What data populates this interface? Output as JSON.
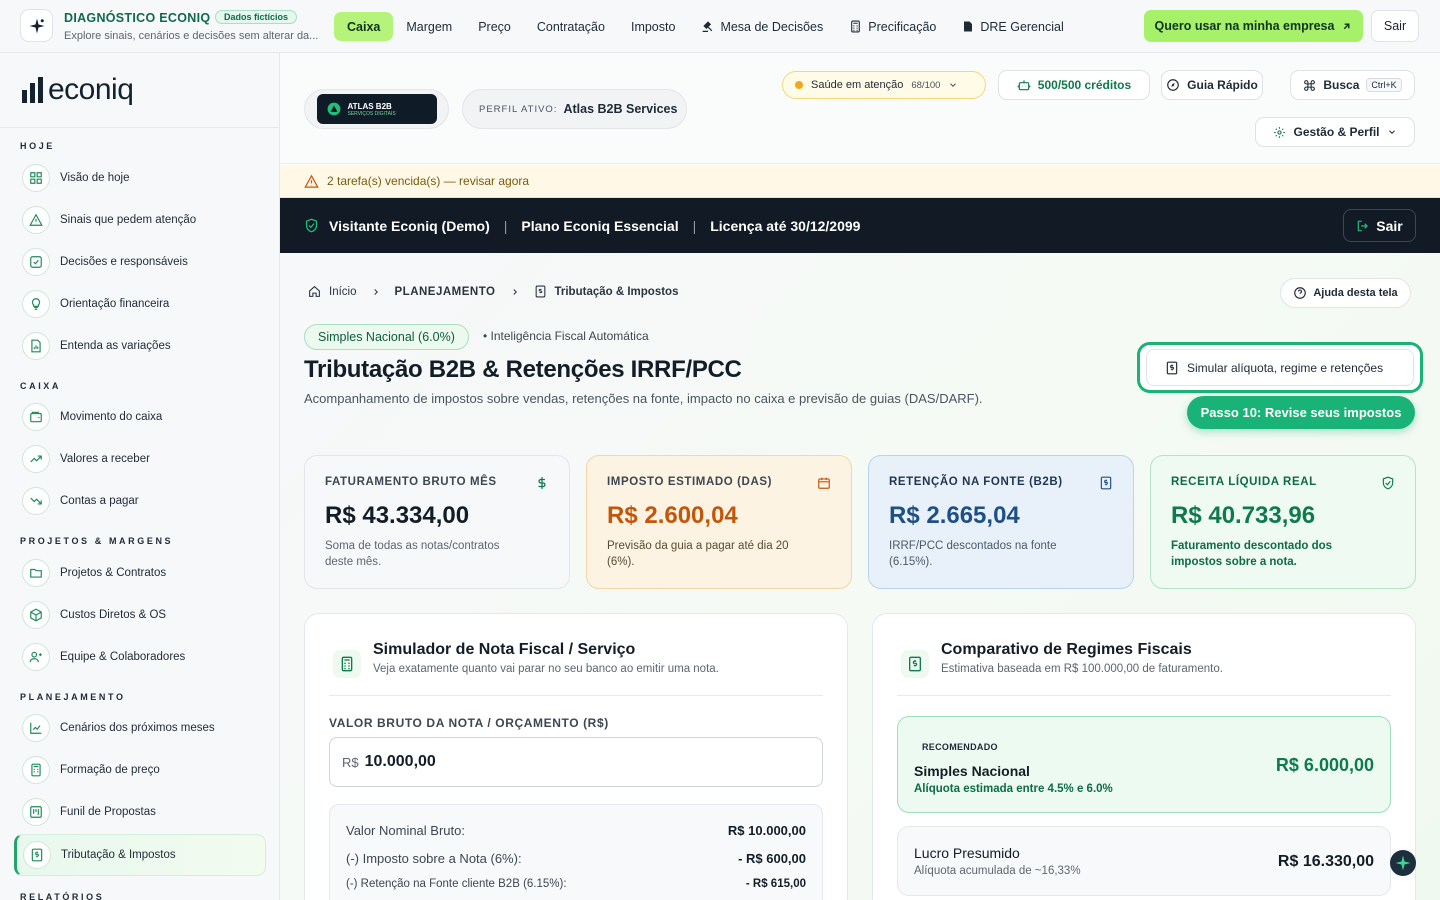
{
  "topbar": {
    "title": "DIAGNÓSTICO ECONIQ",
    "badge": "Dados fictícios",
    "subtitle": "Explore sinais, cenários e decisões sem alterar da...",
    "nav": [
      {
        "label": "Caixa",
        "icon": ""
      },
      {
        "label": "Margem",
        "icon": ""
      },
      {
        "label": "Preço",
        "icon": ""
      },
      {
        "label": "Contratação",
        "icon": ""
      },
      {
        "label": "Imposto",
        "icon": ""
      },
      {
        "label": "Mesa de Decisões",
        "icon": "gavel-icon"
      },
      {
        "label": "Precificação",
        "icon": "calculator-icon"
      },
      {
        "label": "DRE Gerencial",
        "icon": "document-icon"
      }
    ],
    "cta": "Quero usar na minha empresa",
    "exit": "Sair"
  },
  "sidebar": {
    "brand": "econiq",
    "sections": [
      {
        "title": "HOJE",
        "items": [
          "Visão de hoje",
          "Sinais que pedem atenção",
          "Decisões e responsáveis",
          "Orientação financeira",
          "Entenda as variações"
        ]
      },
      {
        "title": "CAIXA",
        "items": [
          "Movimento do caixa",
          "Valores a receber",
          "Contas a pagar"
        ]
      },
      {
        "title": "PROJETOS & MARGENS",
        "items": [
          "Projetos & Contratos",
          "Custos Diretos & OS",
          "Equipe & Colaboradores"
        ]
      },
      {
        "title": "PLANEJAMENTO",
        "items": [
          "Cenários dos próximos meses",
          "Formação de preço",
          "Funil de Propostas",
          "Tributação & Impostos"
        ]
      },
      {
        "title": "RELATÓRIOS",
        "items": []
      }
    ]
  },
  "header": {
    "account_name": "ATLAS B2B",
    "account_tagline": "SERVIÇOS DIGITAIS",
    "profile_key": "PERFIL ATIVO:",
    "profile_value": "Atlas B2B Services",
    "health_label": "Saúde em atenção",
    "health_score": "68/100",
    "credits": "500/500 créditos",
    "guide": "Guia Rápido",
    "search": "Busca",
    "search_kbd": "Ctrl+K",
    "settings": "Gestão & Perfil"
  },
  "alert": "2 tarefa(s) vencida(s) — revisar agora",
  "darkbar": {
    "user": "Visitante Econiq (Demo)",
    "plan": "Plano Econiq Essencial",
    "license": "Licença até 30/12/2099",
    "exit": "Sair"
  },
  "breadcrumb": {
    "home": "Início",
    "section": "PLANEJAMENTO",
    "page": "Tributação & Impostos"
  },
  "help": "Ajuda desta tela",
  "page": {
    "tag": "Simples Nacional (6.0%)",
    "tag2": "• Inteligência Fiscal Automática",
    "title": "Tributação B2B & Retenções IRRF/PCC",
    "subtitle": "Acompanhamento de impostos sobre vendas, retenções na fonte, impacto no caixa e previsão de guias (DAS/DARF).",
    "sim_button": "Simular alíquota, regime e retenções",
    "step": "Passo 10: Revise seus impostos"
  },
  "kpis": [
    {
      "title": "FATURAMENTO BRUTO MÊS",
      "value": "R$ 43.334,00",
      "desc": "Soma de todas as notas/contratos deste mês.",
      "color": "#131d28"
    },
    {
      "title": "IMPOSTO ESTIMADO (DAS)",
      "value": "R$ 2.600,04",
      "desc": "Previsão da guia a pagar até dia 20 (6%).",
      "color": "#c2570c"
    },
    {
      "title": "RETENÇÃO NA FONTE (B2B)",
      "value": "R$ 2.665,04",
      "desc": "IRRF/PCC descontados na fonte (6.15%).",
      "color": "#1e4f86"
    },
    {
      "title": "RECEITA LÍQUIDA REAL",
      "value": "R$ 40.733,96",
      "desc": "Faturamento descontado dos impostos sobre a nota.",
      "color": "#0f7a4e"
    }
  ],
  "simulator": {
    "title": "Simulador de Nota Fiscal / Serviço",
    "subtitle": "Veja exatamente quanto vai parar no seu banco ao emitir uma nota.",
    "input_label": "VALOR BRUTO DA NOTA / ORÇAMENTO (R$)",
    "currency": "R$",
    "input_value": "10.000,00",
    "rows": [
      {
        "label": "Valor Nominal Bruto:",
        "value": "R$ 10.000,00"
      },
      {
        "label": "(-) Imposto sobre a Nota (6%):",
        "value": "- R$ 600,00"
      },
      {
        "label": "(-) Retenção na Fonte cliente B2B (6.15%):",
        "value": "- R$ 615,00"
      }
    ]
  },
  "comparison": {
    "title": "Comparativo de Regimes Fiscais",
    "subtitle": "Estimativa baseada em R$ 100.000,00 de faturamento.",
    "recommended_badge": "RECOMENDADO",
    "regimes": [
      {
        "name": "Simples Nacional",
        "desc": "Alíquota estimada entre 4.5% e 6.0%",
        "value": "R$ 6.000,00"
      },
      {
        "name": "Lucro Presumido",
        "desc": "Alíquota acumulada de ~16,33%",
        "value": "R$ 16.330,00"
      }
    ]
  },
  "colors": {
    "accent": "#19b277",
    "cta": "#a6f06a",
    "dark": "#111a25"
  }
}
